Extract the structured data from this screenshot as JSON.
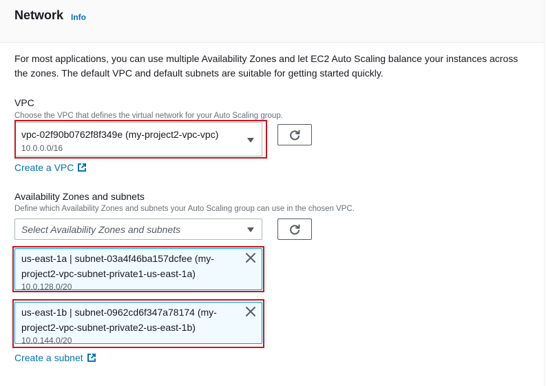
{
  "section": {
    "title": "Network",
    "info_label": "Info"
  },
  "description": "For most applications, you can use multiple Availability Zones and let EC2 Auto Scaling balance your instances across the zones. The default VPC and default subnets are suitable for getting started quickly.",
  "vpc": {
    "label": "VPC",
    "hint": "Choose the VPC that defines the virtual network for your Auto Scaling group.",
    "selected_value": "vpc-02f90b0762f8f349e (my-project2-vpc-vpc)",
    "selected_cidr": "10.0.0.0/16",
    "create_link": "Create a VPC"
  },
  "az_subnets": {
    "label": "Availability Zones and subnets",
    "hint": "Define which Availability Zones and subnets your Auto Scaling group can use in the chosen VPC.",
    "placeholder": "Select Availability Zones and subnets",
    "tokens": [
      {
        "text": "us-east-1a | subnet-03a4f46ba157dcfee (my-project2-vpc-subnet-private1-us-east-1a)",
        "cidr": "10.0.128.0/20"
      },
      {
        "text": "us-east-1b | subnet-0962cd6f347a78174 (my-project2-vpc-subnet-private2-us-east-1b)",
        "cidr": "10.0.144.0/20"
      }
    ],
    "create_link": "Create a subnet"
  },
  "colors": {
    "link": "#0073bb",
    "highlight": "#d0121b",
    "token_bg": "#f1faff",
    "token_border": "#00a1c9"
  }
}
